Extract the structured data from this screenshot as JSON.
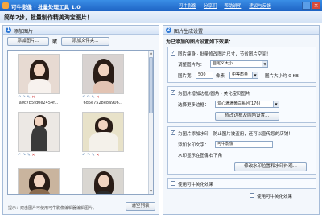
{
  "window": {
    "title": "可牛影像 · 批量处理工具 1.0",
    "links": [
      "可牛影像",
      "分享们",
      "帮助说明",
      "建议与反馈"
    ]
  },
  "banner": {
    "text": "简单2步，批量制作精美淘宝图片！"
  },
  "left_panel": {
    "step": "1",
    "title": "添加图片",
    "add_image_button": "添加图片...",
    "or_label": "或",
    "add_folder_button": "添加文件夹...",
    "images": [
      {
        "filename": "a0c7b5fd0e2454f..."
      },
      {
        "filename": "6d5e7528e8a906..."
      },
      {
        "filename": ""
      },
      {
        "filename": ""
      },
      {
        "filename": ""
      },
      {
        "filename": ""
      }
    ],
    "hint": "提示：双击图片可使用可牛影像编辑器编辑图片。",
    "clear_button": "清空列表"
  },
  "right_panel": {
    "step": "2",
    "title": "图片生成设置",
    "section_title": "为已添加的图片设置如下效果：",
    "resize": {
      "checked": true,
      "label": "图片瘦身 · 批量修改图片尺寸，节省图片空间！",
      "size_label": "调整图片为：",
      "size_value": "自定义大小",
      "width_label": "图片宽",
      "width_value": "500",
      "px_label": "像素",
      "quality_value": "中等质量",
      "approx_label": "图片大小约 0 KB"
    },
    "border": {
      "checked": true,
      "label": "为图片增加边框/圆角 · 美化宝贝图片",
      "style_label": "选择更多边框：",
      "style_value": "爱心满满黄白系列(176)",
      "button": "修改边框及圆角设置..."
    },
    "watermark": {
      "checked": true,
      "label": "为图片添加水印 · 防止图片被盗用，还可以宣传您的店铺！",
      "text_label": "添加水印文字：",
      "text_value": "可牛影像",
      "position_label": "水印显示在图像右下角",
      "button": "修改水印位置和水印外观..."
    },
    "beautify": {
      "checked": false,
      "label": "使用可牛美化效果"
    },
    "beautify2": {
      "checked": false,
      "label": "使用可牛美化效果"
    }
  }
}
